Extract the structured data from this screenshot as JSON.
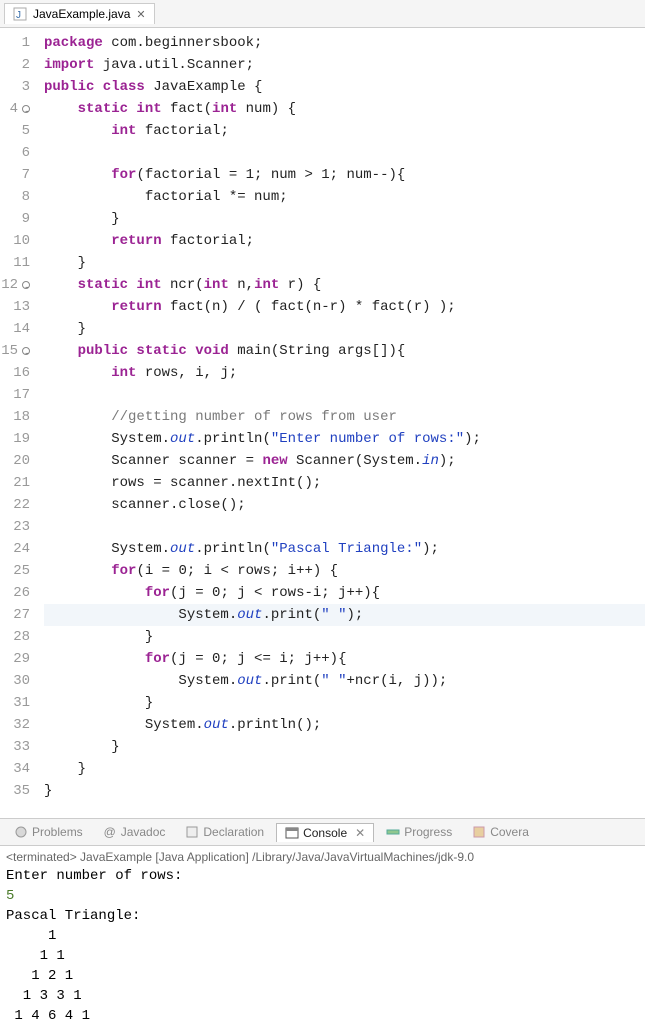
{
  "tab": {
    "filename": "JavaExample.java"
  },
  "code": {
    "lines": [
      {
        "n": 1,
        "fold": false,
        "segs": [
          {
            "t": "package ",
            "c": "kw-purple"
          },
          {
            "t": "com.beginnersbook;",
            "c": "ident"
          }
        ]
      },
      {
        "n": 2,
        "fold": false,
        "segs": [
          {
            "t": "import ",
            "c": "kw-purple"
          },
          {
            "t": "java.util.Scanner;",
            "c": "ident"
          }
        ]
      },
      {
        "n": 3,
        "fold": false,
        "segs": [
          {
            "t": "public class ",
            "c": "kw-purple"
          },
          {
            "t": "JavaExample {",
            "c": "ident"
          }
        ]
      },
      {
        "n": 4,
        "fold": true,
        "segs": [
          {
            "t": "    ",
            "c": ""
          },
          {
            "t": "static int ",
            "c": "kw-purple"
          },
          {
            "t": "fact(",
            "c": "ident"
          },
          {
            "t": "int ",
            "c": "kw-purple"
          },
          {
            "t": "num) {",
            "c": "ident"
          }
        ]
      },
      {
        "n": 5,
        "fold": false,
        "segs": [
          {
            "t": "        ",
            "c": ""
          },
          {
            "t": "int ",
            "c": "kw-purple"
          },
          {
            "t": "factorial;",
            "c": "ident"
          }
        ]
      },
      {
        "n": 6,
        "fold": false,
        "segs": []
      },
      {
        "n": 7,
        "fold": false,
        "segs": [
          {
            "t": "        ",
            "c": ""
          },
          {
            "t": "for",
            "c": "kw-purple"
          },
          {
            "t": "(factorial = 1; num > 1; num--){",
            "c": "ident"
          }
        ]
      },
      {
        "n": 8,
        "fold": false,
        "segs": [
          {
            "t": "            factorial *= num;",
            "c": "ident"
          }
        ]
      },
      {
        "n": 9,
        "fold": false,
        "segs": [
          {
            "t": "        }",
            "c": "ident"
          }
        ]
      },
      {
        "n": 10,
        "fold": false,
        "segs": [
          {
            "t": "        ",
            "c": ""
          },
          {
            "t": "return ",
            "c": "kw-purple"
          },
          {
            "t": "factorial;",
            "c": "ident"
          }
        ]
      },
      {
        "n": 11,
        "fold": false,
        "segs": [
          {
            "t": "    }",
            "c": "ident"
          }
        ]
      },
      {
        "n": 12,
        "fold": true,
        "segs": [
          {
            "t": "    ",
            "c": ""
          },
          {
            "t": "static int ",
            "c": "kw-purple"
          },
          {
            "t": "ncr(",
            "c": "ident"
          },
          {
            "t": "int ",
            "c": "kw-purple"
          },
          {
            "t": "n,",
            "c": "ident"
          },
          {
            "t": "int ",
            "c": "kw-purple"
          },
          {
            "t": "r) {",
            "c": "ident"
          }
        ]
      },
      {
        "n": 13,
        "fold": false,
        "segs": [
          {
            "t": "        ",
            "c": ""
          },
          {
            "t": "return ",
            "c": "kw-purple"
          },
          {
            "t": "fact",
            "c": "nav-meth"
          },
          {
            "t": "(n) / ( ",
            "c": "ident"
          },
          {
            "t": "fact",
            "c": "nav-meth"
          },
          {
            "t": "(n-r) * ",
            "c": "ident"
          },
          {
            "t": "fact",
            "c": "nav-meth"
          },
          {
            "t": "(r) );",
            "c": "ident"
          }
        ]
      },
      {
        "n": 14,
        "fold": false,
        "segs": [
          {
            "t": "    }",
            "c": "ident"
          }
        ]
      },
      {
        "n": 15,
        "fold": true,
        "segs": [
          {
            "t": "    ",
            "c": ""
          },
          {
            "t": "public static void ",
            "c": "kw-purple"
          },
          {
            "t": "main(String args[]){",
            "c": "ident"
          }
        ]
      },
      {
        "n": 16,
        "fold": false,
        "segs": [
          {
            "t": "        ",
            "c": ""
          },
          {
            "t": "int ",
            "c": "kw-purple"
          },
          {
            "t": "rows, i, j;",
            "c": "ident"
          }
        ]
      },
      {
        "n": 17,
        "fold": false,
        "segs": []
      },
      {
        "n": 18,
        "fold": false,
        "segs": [
          {
            "t": "        ",
            "c": ""
          },
          {
            "t": "//getting number of rows from user",
            "c": "comm"
          }
        ]
      },
      {
        "n": 19,
        "fold": false,
        "segs": [
          {
            "t": "        System.",
            "c": "ident"
          },
          {
            "t": "out",
            "c": "kw-blue"
          },
          {
            "t": ".println(",
            "c": "ident"
          },
          {
            "t": "\"Enter number of rows:\"",
            "c": "str"
          },
          {
            "t": ");",
            "c": "ident"
          }
        ]
      },
      {
        "n": 20,
        "fold": false,
        "segs": [
          {
            "t": "        Scanner scanner = ",
            "c": "ident"
          },
          {
            "t": "new ",
            "c": "kw-purple"
          },
          {
            "t": "Scanner(System.",
            "c": "ident"
          },
          {
            "t": "in",
            "c": "kw-blue"
          },
          {
            "t": ");",
            "c": "ident"
          }
        ]
      },
      {
        "n": 21,
        "fold": false,
        "segs": [
          {
            "t": "        rows = scanner.nextInt();",
            "c": "ident"
          }
        ]
      },
      {
        "n": 22,
        "fold": false,
        "segs": [
          {
            "t": "        scanner.close();",
            "c": "ident"
          }
        ]
      },
      {
        "n": 23,
        "fold": false,
        "segs": []
      },
      {
        "n": 24,
        "fold": false,
        "segs": [
          {
            "t": "        System.",
            "c": "ident"
          },
          {
            "t": "out",
            "c": "kw-blue"
          },
          {
            "t": ".println(",
            "c": "ident"
          },
          {
            "t": "\"Pascal Triangle:\"",
            "c": "str"
          },
          {
            "t": ");",
            "c": "ident"
          }
        ]
      },
      {
        "n": 25,
        "fold": false,
        "segs": [
          {
            "t": "        ",
            "c": ""
          },
          {
            "t": "for",
            "c": "kw-purple"
          },
          {
            "t": "(i = 0; i < rows; i++) {",
            "c": "ident"
          }
        ]
      },
      {
        "n": 26,
        "fold": false,
        "segs": [
          {
            "t": "            ",
            "c": ""
          },
          {
            "t": "for",
            "c": "kw-purple"
          },
          {
            "t": "(j = 0; j < rows-i; j++){",
            "c": "ident"
          }
        ]
      },
      {
        "n": 27,
        "fold": false,
        "hl": true,
        "segs": [
          {
            "t": "                System.",
            "c": "ident"
          },
          {
            "t": "out",
            "c": "kw-blue"
          },
          {
            "t": ".print(",
            "c": "ident"
          },
          {
            "t": "\" \"",
            "c": "str"
          },
          {
            "t": ");",
            "c": "ident"
          }
        ]
      },
      {
        "n": 28,
        "fold": false,
        "segs": [
          {
            "t": "            }",
            "c": "ident"
          }
        ]
      },
      {
        "n": 29,
        "fold": false,
        "segs": [
          {
            "t": "            ",
            "c": ""
          },
          {
            "t": "for",
            "c": "kw-purple"
          },
          {
            "t": "(j = 0; j <= i; j++){",
            "c": "ident"
          }
        ]
      },
      {
        "n": 30,
        "fold": false,
        "segs": [
          {
            "t": "                System.",
            "c": "ident"
          },
          {
            "t": "out",
            "c": "kw-blue"
          },
          {
            "t": ".print(",
            "c": "ident"
          },
          {
            "t": "\" \"",
            "c": "str"
          },
          {
            "t": "+",
            "c": "ident"
          },
          {
            "t": "ncr",
            "c": "nav-meth"
          },
          {
            "t": "(i, j));",
            "c": "ident"
          }
        ]
      },
      {
        "n": 31,
        "fold": false,
        "segs": [
          {
            "t": "            }",
            "c": "ident"
          }
        ]
      },
      {
        "n": 32,
        "fold": false,
        "segs": [
          {
            "t": "            System.",
            "c": "ident"
          },
          {
            "t": "out",
            "c": "kw-blue"
          },
          {
            "t": ".println();",
            "c": "ident"
          }
        ]
      },
      {
        "n": 33,
        "fold": false,
        "segs": [
          {
            "t": "        }",
            "c": "ident"
          }
        ]
      },
      {
        "n": 34,
        "fold": false,
        "segs": [
          {
            "t": "    }",
            "c": "ident"
          }
        ]
      },
      {
        "n": 35,
        "fold": false,
        "segs": [
          {
            "t": "}",
            "c": "ident"
          }
        ]
      }
    ]
  },
  "bottom_tabs": {
    "problems": "Problems",
    "javadoc": "Javadoc",
    "declaration": "Declaration",
    "console": "Console",
    "progress": "Progress",
    "coverage": "Covera"
  },
  "console": {
    "status": "<terminated> JavaExample [Java Application] /Library/Java/JavaVirtualMachines/jdk-9.0",
    "out1": "Enter number of rows:",
    "input": "5",
    "out2": "Pascal Triangle:",
    "triangle": "     1\n    1 1\n   1 2 1\n  1 3 3 1\n 1 4 6 4 1"
  }
}
